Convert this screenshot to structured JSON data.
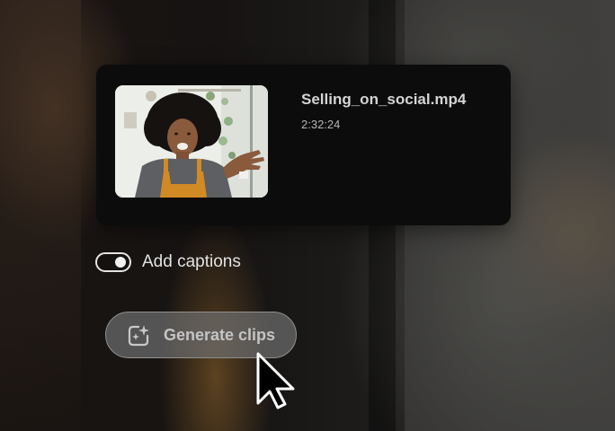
{
  "file": {
    "name": "Selling_on_social.mp4",
    "duration": "2:32:24"
  },
  "captions": {
    "label": "Add captions",
    "enabled": true
  },
  "generate": {
    "label": "Generate clips",
    "icon": "sparkle-clip-icon"
  },
  "colors": {
    "card_bg": "#0c0c0c",
    "button_bg": "#6e6e6e",
    "text": "#e2e2e2"
  }
}
